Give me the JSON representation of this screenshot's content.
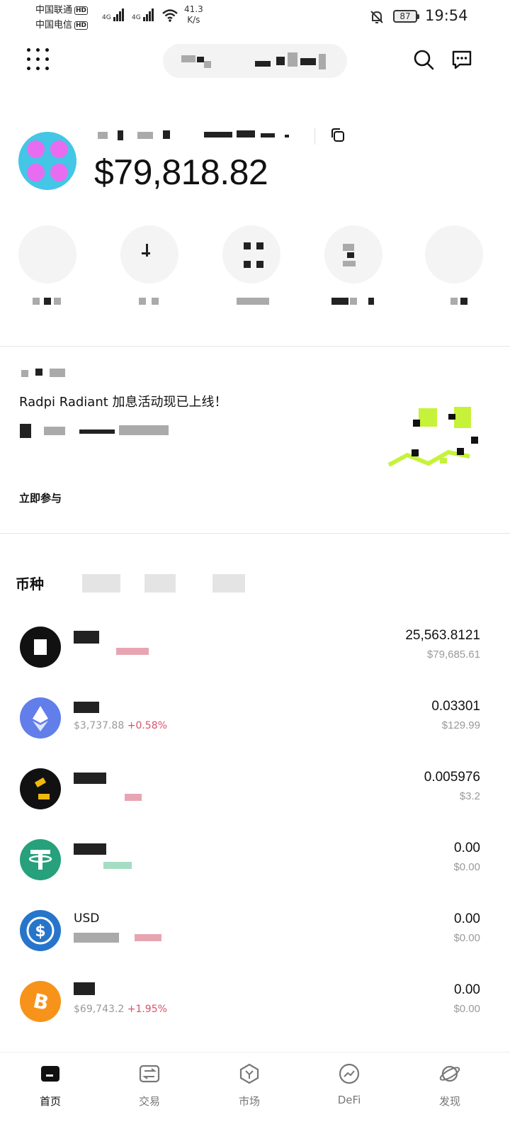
{
  "status_bar": {
    "carrier1": "中国联通",
    "carrier2": "中国电信",
    "hd_badge": "HD",
    "network1": "4G",
    "network2": "4G",
    "speed_value": "41.3",
    "speed_unit": "K/s",
    "battery": "87",
    "time": "19:54"
  },
  "wallet": {
    "balance": "$79,818.82"
  },
  "banner": {
    "text": "Radpi  Radiant 加息活动现已上线！",
    "cta": "立即参与"
  },
  "assets": {
    "tab_label": "币种",
    "rows": [
      {
        "name": "",
        "sub_price": "",
        "sub_change": "",
        "amount": "25,563.8121",
        "fiat": "$79,685.61",
        "color": "#111111"
      },
      {
        "name": "",
        "sub_price": "$3,737.88",
        "sub_change": "+0.58%",
        "amount": "0.03301",
        "fiat": "$129.99",
        "color": "#627eea"
      },
      {
        "name": "",
        "sub_price": "",
        "sub_change": "",
        "amount": "0.005976",
        "fiat": "$3.2",
        "color": "#111111"
      },
      {
        "name": "",
        "sub_price": "",
        "sub_change": "",
        "amount": "0.00",
        "fiat": "$0.00",
        "color": "#26a17b"
      },
      {
        "name": "USD",
        "sub_price": "",
        "sub_change": "",
        "amount": "0.00",
        "fiat": "$0.00",
        "color": "#2775ca"
      },
      {
        "name": "",
        "sub_price": "$69,743.2",
        "sub_change": "+1.95%",
        "amount": "0.00",
        "fiat": "$0.00",
        "color": "#f7931a"
      }
    ]
  },
  "nav": {
    "items": [
      {
        "label": "首页",
        "icon": "wallet-icon"
      },
      {
        "label": "交易",
        "icon": "swap-icon"
      },
      {
        "label": "市场",
        "icon": "market-icon"
      },
      {
        "label": "DeFi",
        "icon": "defi-icon"
      },
      {
        "label": "发现",
        "icon": "discover-icon"
      }
    ]
  },
  "colors": {
    "accent": "#111111",
    "positive_change": "#d9506a",
    "muted": "#999999"
  }
}
